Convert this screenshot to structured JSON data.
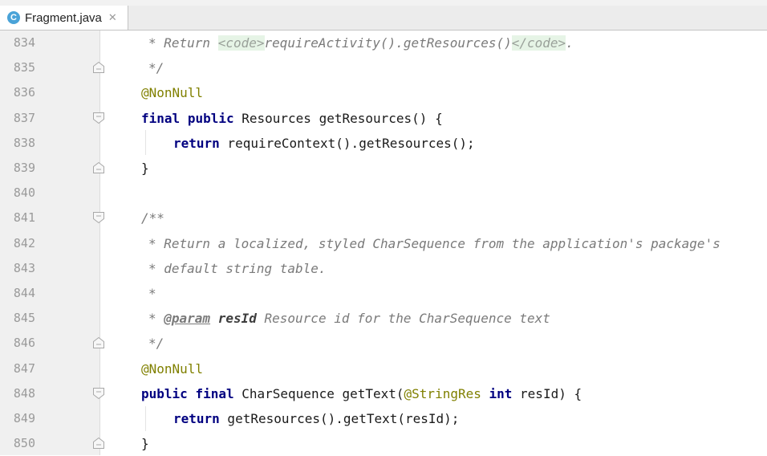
{
  "tab": {
    "title": "Fragment.java",
    "icon": "java-class-icon",
    "icon_letter": "C"
  },
  "editor": {
    "lines": [
      {
        "number": "834",
        "fold": "none",
        "indent": 185,
        "tokens": [
          {
            "t": "* Return ",
            "c": "doc"
          },
          {
            "t": "<code>",
            "c": "tagc"
          },
          {
            "t": "requireActivity().getResources()",
            "c": "doc"
          },
          {
            "t": "</code>",
            "c": "tagc"
          },
          {
            "t": ".",
            "c": "doc"
          }
        ]
      },
      {
        "number": "835",
        "fold": "end",
        "indent": 185,
        "tokens": [
          {
            "t": "*/",
            "c": "doc"
          }
        ]
      },
      {
        "number": "836",
        "fold": "none",
        "indent": 176,
        "tokens": [
          {
            "t": "@NonNull",
            "c": "ann"
          }
        ]
      },
      {
        "number": "837",
        "fold": "start",
        "indent": 176,
        "tokens": [
          {
            "t": "final",
            "c": "kw"
          },
          {
            "t": " ",
            "c": ""
          },
          {
            "t": "public",
            "c": "kw"
          },
          {
            "t": " Resources getResources() {",
            "c": ""
          }
        ]
      },
      {
        "number": "838",
        "fold": "none",
        "indent": 216,
        "tokens": [
          {
            "t": "return",
            "c": "kw"
          },
          {
            "t": " requireContext().getResources();",
            "c": ""
          }
        ]
      },
      {
        "number": "839",
        "fold": "end",
        "indent": 176,
        "tokens": [
          {
            "t": "}",
            "c": ""
          }
        ]
      },
      {
        "number": "840",
        "fold": "none",
        "indent": 176,
        "tokens": []
      },
      {
        "number": "841",
        "fold": "start",
        "indent": 176,
        "tokens": [
          {
            "t": "/**",
            "c": "doc"
          }
        ]
      },
      {
        "number": "842",
        "fold": "none",
        "indent": 185,
        "tokens": [
          {
            "t": "* Return a localized, styled CharSequence from the application's package's",
            "c": "doc"
          }
        ]
      },
      {
        "number": "843",
        "fold": "none",
        "indent": 185,
        "tokens": [
          {
            "t": "* default string table.",
            "c": "doc"
          }
        ]
      },
      {
        "number": "844",
        "fold": "none",
        "indent": 185,
        "tokens": [
          {
            "t": "*",
            "c": "doc"
          }
        ]
      },
      {
        "number": "845",
        "fold": "none",
        "indent": 185,
        "tokens": [
          {
            "t": "* ",
            "c": "doc"
          },
          {
            "t": "@param",
            "c": "doctag"
          },
          {
            "t": " ",
            "c": "doc"
          },
          {
            "t": "resId",
            "c": "docparam"
          },
          {
            "t": " Resource id for the CharSequence text",
            "c": "doc"
          }
        ]
      },
      {
        "number": "846",
        "fold": "end",
        "indent": 185,
        "tokens": [
          {
            "t": "*/",
            "c": "doc"
          }
        ]
      },
      {
        "number": "847",
        "fold": "none",
        "indent": 176,
        "tokens": [
          {
            "t": "@NonNull",
            "c": "ann"
          }
        ]
      },
      {
        "number": "848",
        "fold": "start",
        "indent": 176,
        "tokens": [
          {
            "t": "public",
            "c": "kw"
          },
          {
            "t": " ",
            "c": ""
          },
          {
            "t": "final",
            "c": "kw"
          },
          {
            "t": " CharSequence getText(",
            "c": ""
          },
          {
            "t": "@StringRes",
            "c": "ann"
          },
          {
            "t": " ",
            "c": ""
          },
          {
            "t": "int",
            "c": "kw"
          },
          {
            "t": " resId) {",
            "c": ""
          }
        ]
      },
      {
        "number": "849",
        "fold": "none",
        "indent": 216,
        "tokens": [
          {
            "t": "return",
            "c": "kw"
          },
          {
            "t": " getResources().getText(resId);",
            "c": ""
          }
        ]
      },
      {
        "number": "850",
        "fold": "end",
        "indent": 176,
        "tokens": [
          {
            "t": "}",
            "c": ""
          }
        ]
      }
    ]
  }
}
